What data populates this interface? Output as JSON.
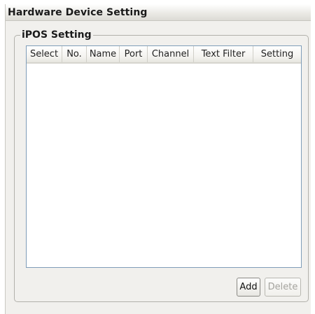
{
  "panel": {
    "title": "Hardware Device Setting"
  },
  "group": {
    "label": "iPOS Setting"
  },
  "table": {
    "columns": [
      "Select",
      "No.",
      "Name",
      "Port",
      "Channel",
      "Text Filter",
      "Setting"
    ],
    "rows": []
  },
  "buttons": {
    "add": "Add",
    "delete": "Delete"
  }
}
